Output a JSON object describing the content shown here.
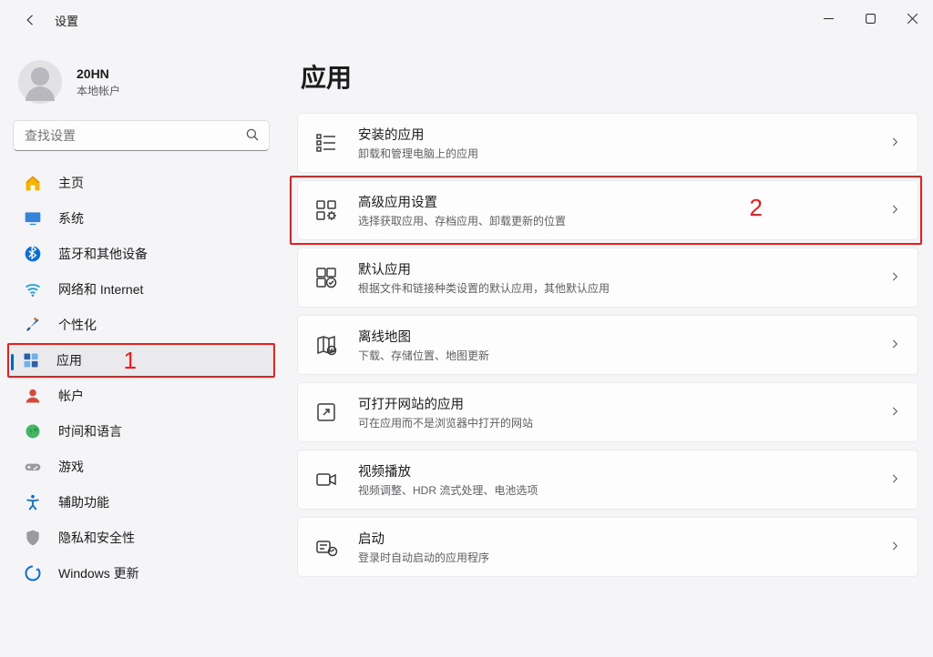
{
  "titlebar": {
    "app_title": "设置"
  },
  "account": {
    "name": "20HN",
    "type": "本地帐户"
  },
  "search": {
    "placeholder": "查找设置"
  },
  "nav": {
    "items": [
      {
        "id": "home",
        "label": "主页",
        "icon": "home",
        "color": "#f5b400"
      },
      {
        "id": "system",
        "label": "系统",
        "icon": "system",
        "color": "#3583d6"
      },
      {
        "id": "bluetooth",
        "label": "蓝牙和其他设备",
        "icon": "bluetooth",
        "color": "#0a6fd8"
      },
      {
        "id": "network",
        "label": "网络和 Internet",
        "icon": "wifi",
        "color": "#1aa0e8"
      },
      {
        "id": "personal",
        "label": "个性化",
        "icon": "brush",
        "color": "#e66b1e"
      },
      {
        "id": "apps",
        "label": "应用",
        "icon": "apps",
        "color": "#2b5fb3",
        "selected": true,
        "annotation": "1"
      },
      {
        "id": "accounts",
        "label": "帐户",
        "icon": "person",
        "color": "#d54a3a"
      },
      {
        "id": "time",
        "label": "时间和语言",
        "icon": "globe",
        "color": "#2f9e49"
      },
      {
        "id": "gaming",
        "label": "游戏",
        "icon": "gamepad",
        "color": "#888"
      },
      {
        "id": "access",
        "label": "辅助功能",
        "icon": "access",
        "color": "#0a6fd8"
      },
      {
        "id": "privacy",
        "label": "隐私和安全性",
        "icon": "shield",
        "color": "#888"
      },
      {
        "id": "update",
        "label": "Windows 更新",
        "icon": "update",
        "color": "#0a6fd8"
      }
    ]
  },
  "page": {
    "title": "应用",
    "cards": [
      {
        "id": "installed",
        "title": "安装的应用",
        "desc": "卸载和管理电脑上的应用",
        "icon": "list"
      },
      {
        "id": "advanced",
        "title": "高级应用设置",
        "desc": "选择获取应用、存档应用、卸载更新的位置",
        "icon": "gear-grid",
        "annotation": "2"
      },
      {
        "id": "defaults",
        "title": "默认应用",
        "desc": "根据文件和链接种类设置的默认应用，其他默认应用",
        "icon": "check-grid"
      },
      {
        "id": "maps",
        "title": "离线地图",
        "desc": "下载、存储位置、地图更新",
        "icon": "map"
      },
      {
        "id": "websites",
        "title": "可打开网站的应用",
        "desc": "可在应用而不是浏览器中打开的网站",
        "icon": "open-external"
      },
      {
        "id": "video",
        "title": "视频播放",
        "desc": "视频调整、HDR 流式处理、电池选项",
        "icon": "video"
      },
      {
        "id": "startup",
        "title": "启动",
        "desc": "登录时自动启动的应用程序",
        "icon": "startup"
      }
    ]
  },
  "annotations": {
    "1": "1",
    "2": "2"
  }
}
